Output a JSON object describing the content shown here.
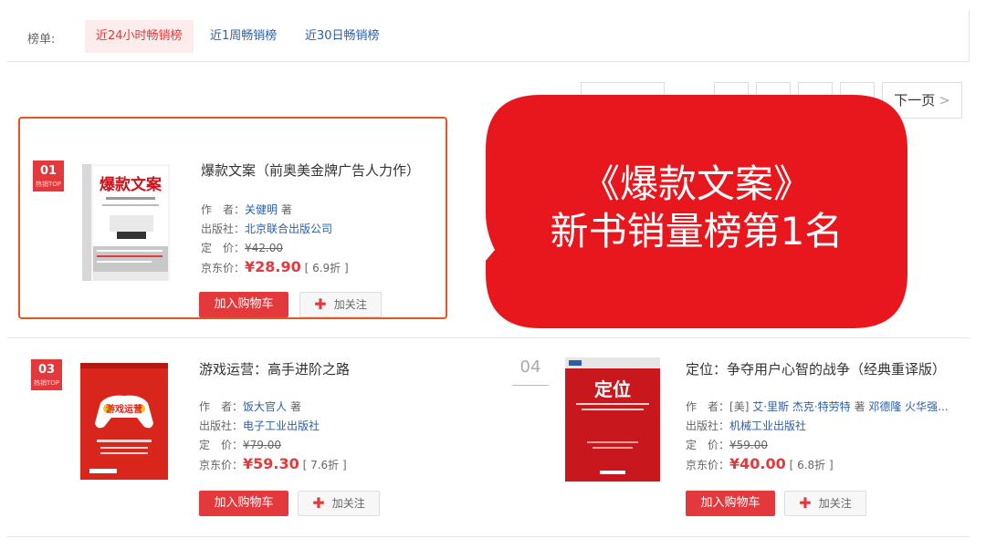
{
  "tabs": {
    "label": "榜单:",
    "items": [
      "近24小时畅销榜",
      "近1周畅销榜",
      "近30日畅销榜"
    ]
  },
  "pager": {
    "next_label": "下一页"
  },
  "books": [
    {
      "rank": "01",
      "rank_sub": "热销TOP",
      "title": "爆款文案（前奥美金牌广告人力作）",
      "author_label": "作　者：",
      "author": "关健明",
      "author_suffix": "著",
      "publisher_label": "出版社：",
      "publisher": "北京联合出版公司",
      "list_price_label": "定　价：",
      "list_price": "¥42.00",
      "jd_price_label": "京东价：",
      "jd_price": "¥28.90",
      "discount": "[ 6.9折 ]",
      "cover_title": "爆款文案",
      "cover_color": "#ffffff"
    },
    {
      "rank": "03",
      "rank_sub": "热销TOP",
      "title": "游戏运营：高手进阶之路",
      "author_label": "作　者：",
      "author": "饭大官人",
      "author_suffix": "著",
      "publisher_label": "出版社：",
      "publisher": "电子工业出版社",
      "list_price_label": "定　价：",
      "list_price": "¥79.00",
      "jd_price_label": "京东价：",
      "jd_price": "¥59.30",
      "discount": "[ 7.6折 ]",
      "cover_title": "游戏运营",
      "cover_color": "#d9261c"
    },
    {
      "rank": "04",
      "title": "定位：争夺用户心智的战争（经典重译版）",
      "author_label": "作　者：",
      "author_prefix": "[美]",
      "author": "艾·里斯 杰克·特劳特",
      "author_suffix": "著",
      "translator": "邓德隆 火华强...",
      "publisher_label": "出版社：",
      "publisher": "机械工业出版社",
      "list_price_label": "定　价：",
      "list_price": "¥59.00",
      "jd_price_label": "京东价：",
      "jd_price": "¥40.00",
      "discount": "[ 6.8折 ]",
      "cover_title": "定位",
      "cover_color": "#c8181e"
    }
  ],
  "buttons": {
    "add_cart": "加入购物车",
    "follow": "加关注"
  },
  "callout": {
    "line1": "《爆款文案》",
    "line2": "新书销量榜第1名",
    "color": "#e8161d"
  },
  "colors": {
    "accent": "#e4393c",
    "link": "#2a5fa8",
    "highlight_border": "#e9531f"
  }
}
